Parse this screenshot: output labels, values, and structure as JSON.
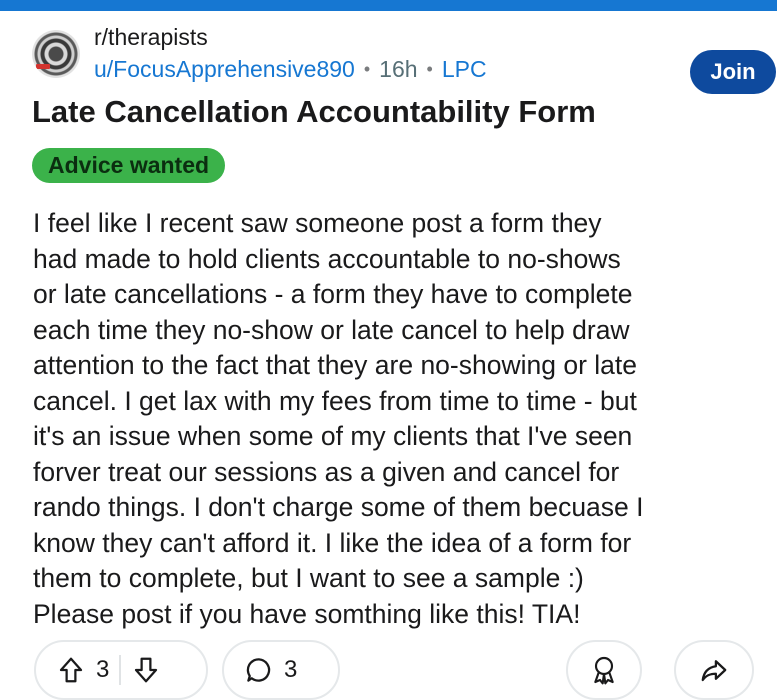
{
  "header": {
    "subreddit": "r/therapists",
    "username": "u/FocusApprehensive890",
    "time": "16h",
    "flair": "LPC",
    "join_label": "Join"
  },
  "post": {
    "title": "Late Cancellation Accountability Form",
    "flair": "Advice wanted",
    "body_lines": [
      "I feel like I recent saw someone post a form they",
      "had made to hold clients accountable to no-shows",
      "or late cancellations - a form they have to complete",
      "each time they no-show or late cancel to help draw",
      "attention to the fact that they are no-showing or late",
      "cancel. I get lax with my fees from time to time - but",
      "it's an issue when some of my clients that I've seen",
      "forver treat our sessions as a given and cancel for",
      "rando things. I don't charge some of them becuase I",
      "know they can't afford it. I like the idea of a form for",
      "them to complete, but I want to see a sample :)",
      "Please post if you have somthing like this! TIA!"
    ]
  },
  "actions": {
    "vote_count": "3",
    "comment_count": "3",
    "icons": [
      "upvote-icon",
      "downvote-icon",
      "comment-icon",
      "award-icon",
      "share-icon"
    ]
  },
  "colors": {
    "accent": "#1677d2",
    "join_button": "#0e4a9e",
    "flair_bg": "#3bb24a"
  }
}
